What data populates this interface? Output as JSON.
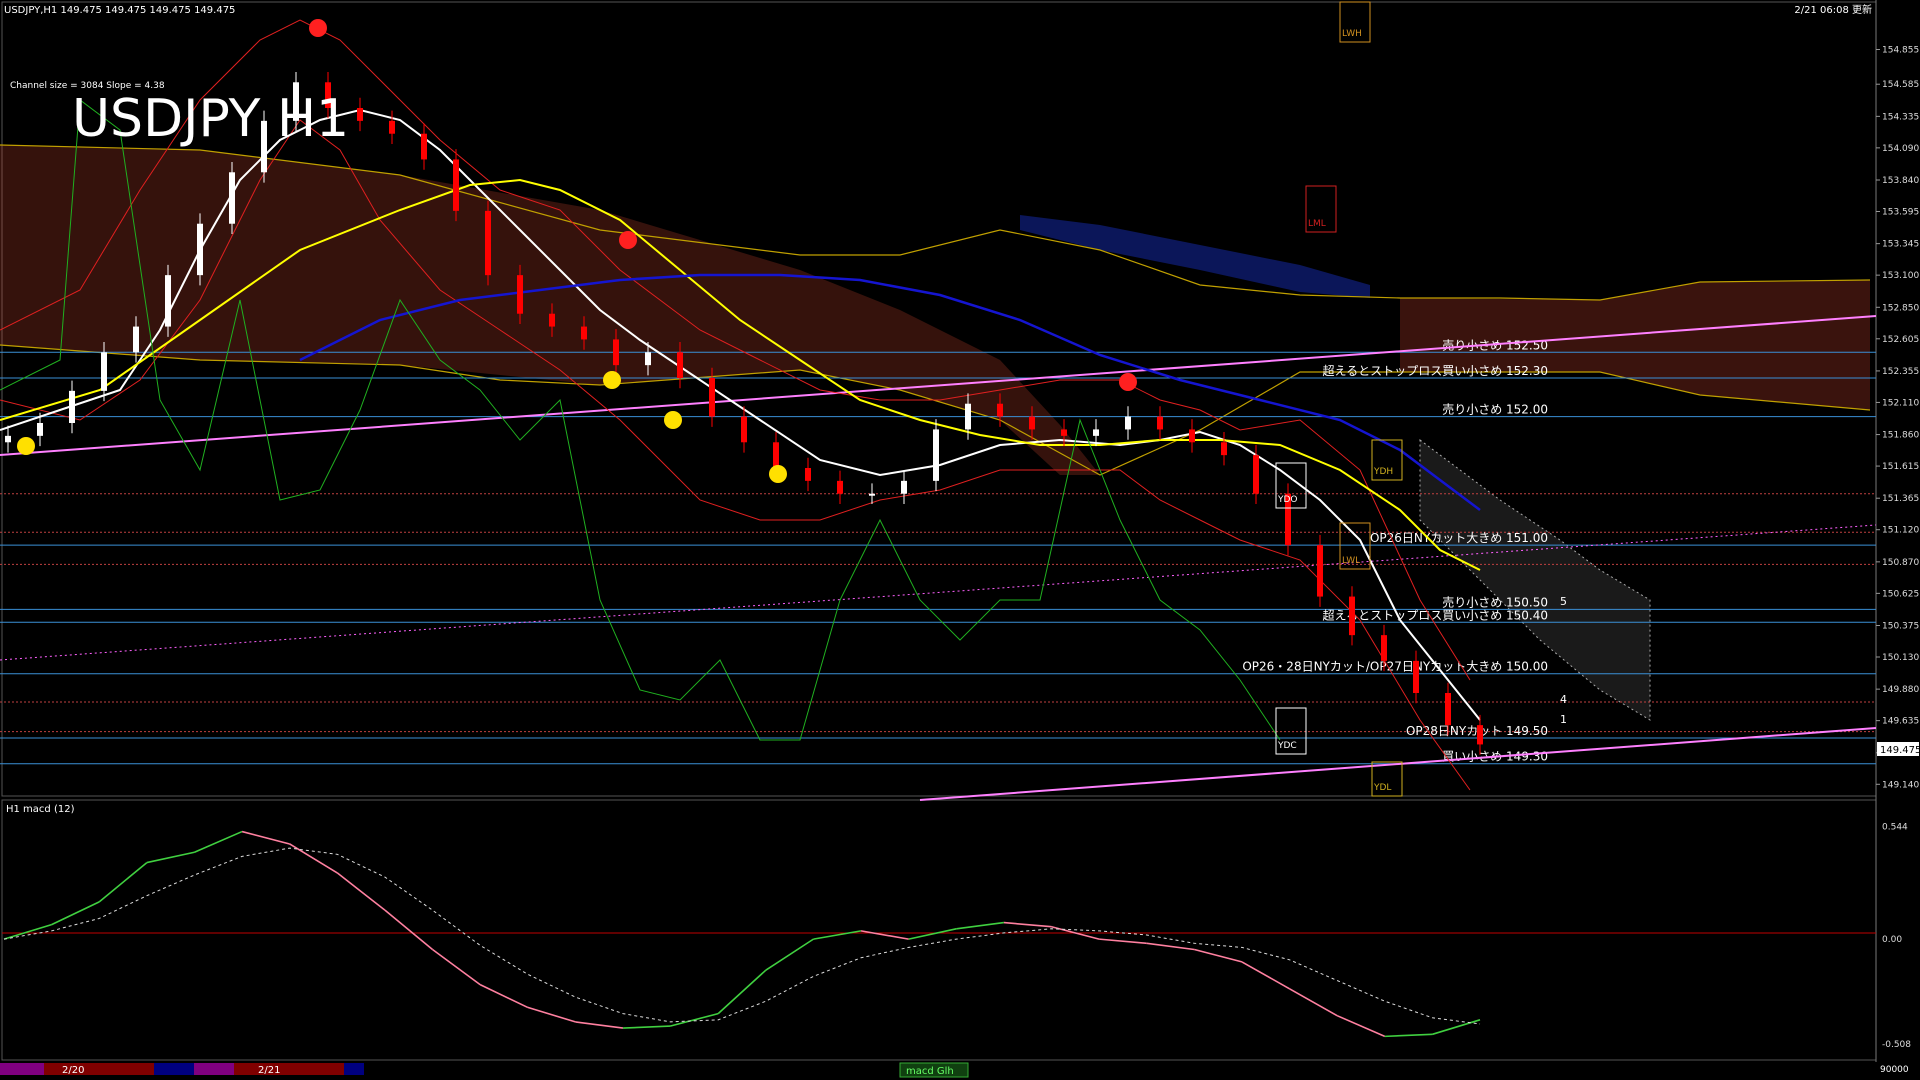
{
  "header": {
    "symbol_info": "USDJPY,H1  149.475 149.475 149.475 149.475",
    "datetime": "2/21 06:08 更新",
    "channel_info": "Channel size = 3084 Slope = 4.38",
    "big_title": "USDJPY H1"
  },
  "colors": {
    "background": "#000000",
    "bull_candle": "#ffffff",
    "bear_candle": "#ff0000",
    "ma_fast": "#ffffff",
    "ma_mid": "#ffff00",
    "ma_slow": "#1515d0",
    "kumo_bear": "#e05030",
    "kumo_bull": "#3050ff",
    "chikou": "#20b020",
    "trendline": "#ff80ff",
    "hline": "#3a8fd6",
    "macd_up": "#40d040",
    "macd_down": "#ff80a0",
    "level_label": "#ffffff"
  },
  "price_axis": {
    "ticks": [
      "154.855",
      "154.585",
      "154.335",
      "154.090",
      "153.840",
      "153.595",
      "153.345",
      "153.100",
      "152.850",
      "152.605",
      "152.355",
      "152.110",
      "151.860",
      "151.615",
      "151.365",
      "151.120",
      "150.870",
      "150.625",
      "150.375",
      "150.130",
      "149.880",
      "149.635",
      "149.385",
      "149.140"
    ],
    "current": "149.475",
    "range": [
      149.08,
      155.1
    ]
  },
  "macd_axis": {
    "ticks": [
      "0.544",
      "0.00",
      "-0.508"
    ],
    "range": [
      -0.56,
      0.6
    ]
  },
  "macd_title": "H1  macd (12)",
  "levels": [
    {
      "price": 152.5,
      "label": "売り小さめ 152.50"
    },
    {
      "price": 152.3,
      "label": "超えるとストップロス買い小さめ 152.30"
    },
    {
      "price": 152.0,
      "label": "売り小さめ 152.00"
    },
    {
      "price": 151.0,
      "label": "OP26日NYカット大きめ 151.00"
    },
    {
      "price": 150.5,
      "label": "売り小さめ 150.50"
    },
    {
      "price": 150.4,
      "label": "超えるとストップロス買い小さめ 150.40"
    },
    {
      "price": 150.0,
      "label": "OP26・28日NYカット/OP27日NYカット大きめ 150.00"
    },
    {
      "price": 149.5,
      "label": "OP28日NYカット 149.50"
    },
    {
      "price": 149.3,
      "label": "買い小さめ 149.30"
    }
  ],
  "boxes": [
    {
      "label": "LWH",
      "color": "#d09020"
    },
    {
      "label": "LML",
      "color": "#d02020"
    },
    {
      "label": "YDH",
      "color": "#d0b020"
    },
    {
      "label": "YDO",
      "color": "#ffffff"
    },
    {
      "label": "LWL",
      "color": "#d09020"
    },
    {
      "label": "YDC",
      "color": "#ffffff"
    },
    {
      "label": "YDL",
      "color": "#d0b020"
    }
  ],
  "right_tags": [
    "5",
    "4",
    "1"
  ],
  "date_strip": {
    "dates": [
      "2/20",
      "2/21"
    ],
    "tab_label": "macd Glh"
  },
  "macd_bottom_label": "90000",
  "chart_data": {
    "type": "line",
    "title": "USDJPY H1",
    "series": [
      {
        "values": [
          151.85,
          151.95,
          152.2,
          152.5,
          152.7,
          153.1,
          153.5,
          153.9,
          154.3,
          154.6,
          154.4,
          154.3,
          154.2,
          154.0,
          153.6,
          153.1,
          152.8,
          152.7,
          152.6,
          152.4,
          152.5,
          152.3,
          152.0,
          151.8,
          151.6,
          151.5,
          151.4,
          151.4,
          151.5,
          151.9,
          152.1,
          152.0,
          151.9,
          151.85,
          151.9,
          152.0,
          151.9,
          151.8,
          151.7,
          151.4,
          151.0,
          150.6,
          150.3,
          150.1,
          149.85,
          149.6,
          149.45
        ]
      }
    ],
    "macd": [
      {
        "name": "macd",
        "values": [
          0.0,
          0.07,
          0.18,
          0.37,
          0.42,
          0.52,
          0.46,
          0.32,
          0.14,
          -0.05,
          -0.22,
          -0.33,
          -0.4,
          -0.43,
          -0.42,
          -0.36,
          -0.15,
          0.0,
          0.04,
          0.0,
          0.05,
          0.08,
          0.06,
          0.0,
          -0.02,
          -0.05,
          -0.11,
          -0.24,
          -0.37,
          -0.47,
          -0.46,
          -0.39
        ]
      },
      {
        "name": "signal",
        "values": [
          0.0,
          0.04,
          0.1,
          0.21,
          0.31,
          0.4,
          0.44,
          0.41,
          0.3,
          0.14,
          -0.03,
          -0.17,
          -0.28,
          -0.36,
          -0.4,
          -0.39,
          -0.3,
          -0.18,
          -0.09,
          -0.04,
          0.0,
          0.03,
          0.05,
          0.04,
          0.02,
          -0.02,
          -0.04,
          -0.1,
          -0.2,
          -0.3,
          -0.38,
          -0.41
        ]
      }
    ]
  }
}
